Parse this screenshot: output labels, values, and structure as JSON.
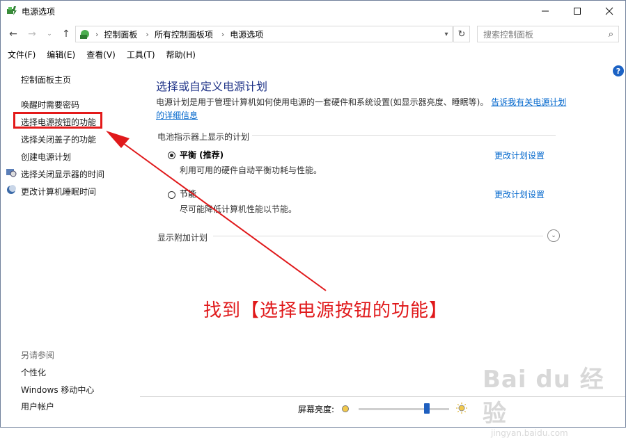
{
  "window": {
    "title": "电源选项"
  },
  "nav": {
    "breadcrumb": [
      "控制面板",
      "所有控制面板项",
      "电源选项"
    ],
    "search_placeholder": "搜索控制面板"
  },
  "menu": [
    "文件(F)",
    "编辑(E)",
    "查看(V)",
    "工具(T)",
    "帮助(H)"
  ],
  "sidebar": {
    "home": "控制面板主页",
    "items": [
      "唤醒时需要密码",
      "选择电源按钮的功能",
      "选择关闭盖子的功能",
      "创建电源计划",
      "选择关闭显示器的时间",
      "更改计算机睡眠时间"
    ],
    "see_also_title": "另请参阅",
    "see_also": [
      "个性化",
      "Windows 移动中心",
      "用户帐户"
    ]
  },
  "main": {
    "heading": "选择或自定义电源计划",
    "description": "电源计划是用于管理计算机如何使用电源的一套硬件和系统设置(如显示器亮度、睡眠等)。",
    "description_link": "告诉我有关电源计划的详细信息",
    "group_label": "电池指示器上显示的计划",
    "plans": [
      {
        "name": "平衡 (推荐)",
        "desc": "利用可用的硬件自动平衡功耗与性能。",
        "selected": true,
        "change": "更改计划设置"
      },
      {
        "name": "节能",
        "desc": "尽可能降低计算机性能以节能。",
        "selected": false,
        "change": "更改计划设置"
      }
    ],
    "more_plans": "显示附加计划"
  },
  "bottom": {
    "brightness_label": "屏幕亮度:",
    "brightness_level": 0.75
  },
  "annotation": "找到【选择电源按钮的功能】",
  "watermark": {
    "brand": "Bai du 经验",
    "url": "jingyan.baidu.com"
  },
  "colors": {
    "link": "#0066cc",
    "heading": "#1e3287",
    "annotation": "#e0191b",
    "help": "#1c62c4"
  }
}
